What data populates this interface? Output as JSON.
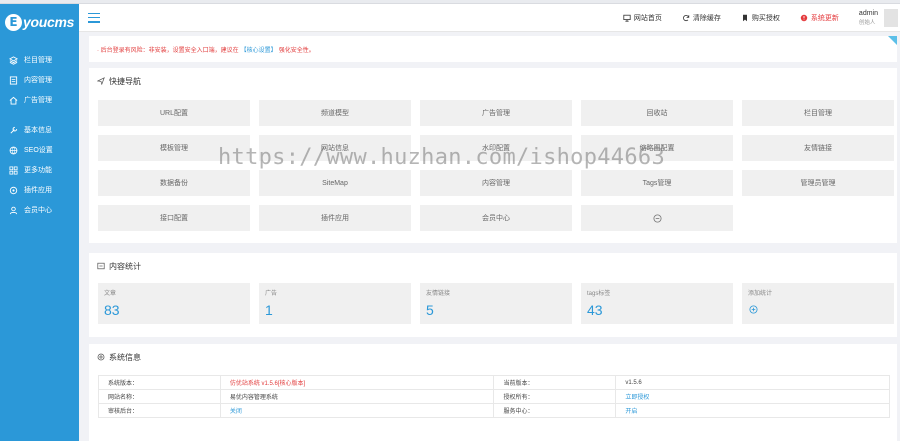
{
  "app": {
    "logo_letter": "E",
    "logo_text": "youcms"
  },
  "sidebar": {
    "items": [
      {
        "label": "栏目管理",
        "icon": "layers-icon"
      },
      {
        "label": "内容管理",
        "icon": "document-icon"
      },
      {
        "label": "广告管理",
        "icon": "home-icon"
      },
      {
        "label": "基本信息",
        "icon": "wrench-icon"
      },
      {
        "label": "SEO设置",
        "icon": "globe-icon"
      },
      {
        "label": "更多功能",
        "icon": "apps-icon"
      },
      {
        "label": "插件应用",
        "icon": "plug-icon"
      },
      {
        "label": "会员中心",
        "icon": "user-icon"
      }
    ]
  },
  "topbar": {
    "links": [
      {
        "label": "网站首页",
        "icon": "monitor-icon"
      },
      {
        "label": "清除缓存",
        "icon": "refresh-icon"
      },
      {
        "label": "购买授权",
        "icon": "bookmark-icon"
      },
      {
        "label": "系统更新",
        "icon": "alert-icon",
        "color": "#e4393c"
      }
    ],
    "user": {
      "name": "admin",
      "role": "创始人"
    }
  },
  "notice": {
    "text_before": "· 后台登录有风险：非安装，设置安全入口端，建议在",
    "link": "【核心设置】",
    "text_after": "强化安全性。"
  },
  "quick_nav": {
    "title": "快捷导航",
    "buttons": [
      "URL配置",
      "频道模型",
      "广告管理",
      "回收站",
      "栏目管理",
      "模板管理",
      "网站信息",
      "水印配置",
      "缩略图配置",
      "友情链接",
      "数据备份",
      "SiteMap",
      "内容管理",
      "Tags管理",
      "管理员管理",
      "接口配置",
      "插件应用",
      "会员中心"
    ]
  },
  "content_stats": {
    "title": "内容统计",
    "items": [
      {
        "label": "文章",
        "value": "83"
      },
      {
        "label": "广告",
        "value": "1"
      },
      {
        "label": "友情链接",
        "value": "5"
      },
      {
        "label": "tags标签",
        "value": "43"
      },
      {
        "label": "添加统计",
        "value": ""
      }
    ]
  },
  "system_info": {
    "title": "系统信息",
    "rows": [
      {
        "k1": "系统版本：",
        "v1": "仿优站系统 v1.5.6[核心版本]",
        "k2": "当前版本：",
        "v2": "v1.5.6"
      },
      {
        "k1": "网站名称：",
        "v1": "易优内容管理系统",
        "k2": "授权所有：",
        "v2": "立即授权"
      },
      {
        "k1": "审核后台：",
        "v1": "关闭",
        "k2": "服务中心：",
        "v2": "开启"
      }
    ]
  },
  "watermark": "https://www.huzhan.com/ishop44663",
  "colors": {
    "brand": "#2b98d8",
    "alert": "#e23d3d"
  }
}
